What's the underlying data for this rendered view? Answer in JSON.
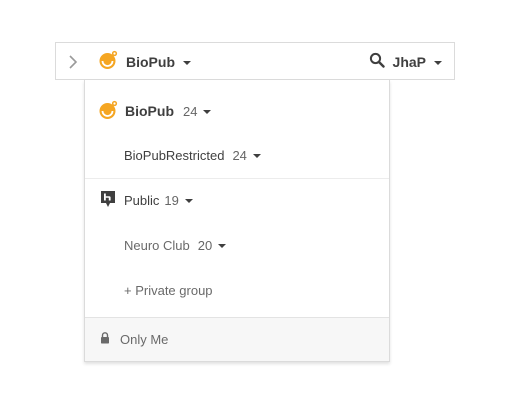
{
  "topbar": {
    "group_name": "BioPub",
    "username": "JhaP",
    "icons": {
      "collapse": "chevron-right-icon",
      "group": "biopub-logo-icon",
      "search": "search-icon"
    }
  },
  "dropdown": {
    "groups": [
      {
        "label": "BioPub",
        "count": "24"
      },
      {
        "label": "BioPubRestricted",
        "count": "24"
      },
      {
        "label": "Public",
        "count": "19"
      },
      {
        "label": "Neuro Club",
        "count": "20"
      }
    ],
    "new_private_group": "+ Private group",
    "only_me": "Only Me"
  },
  "colors": {
    "logo_orange": "#f5a623",
    "text": "#3f3f3f",
    "muted": "#6a6a6a",
    "footer_bg": "#f7f7f7"
  }
}
